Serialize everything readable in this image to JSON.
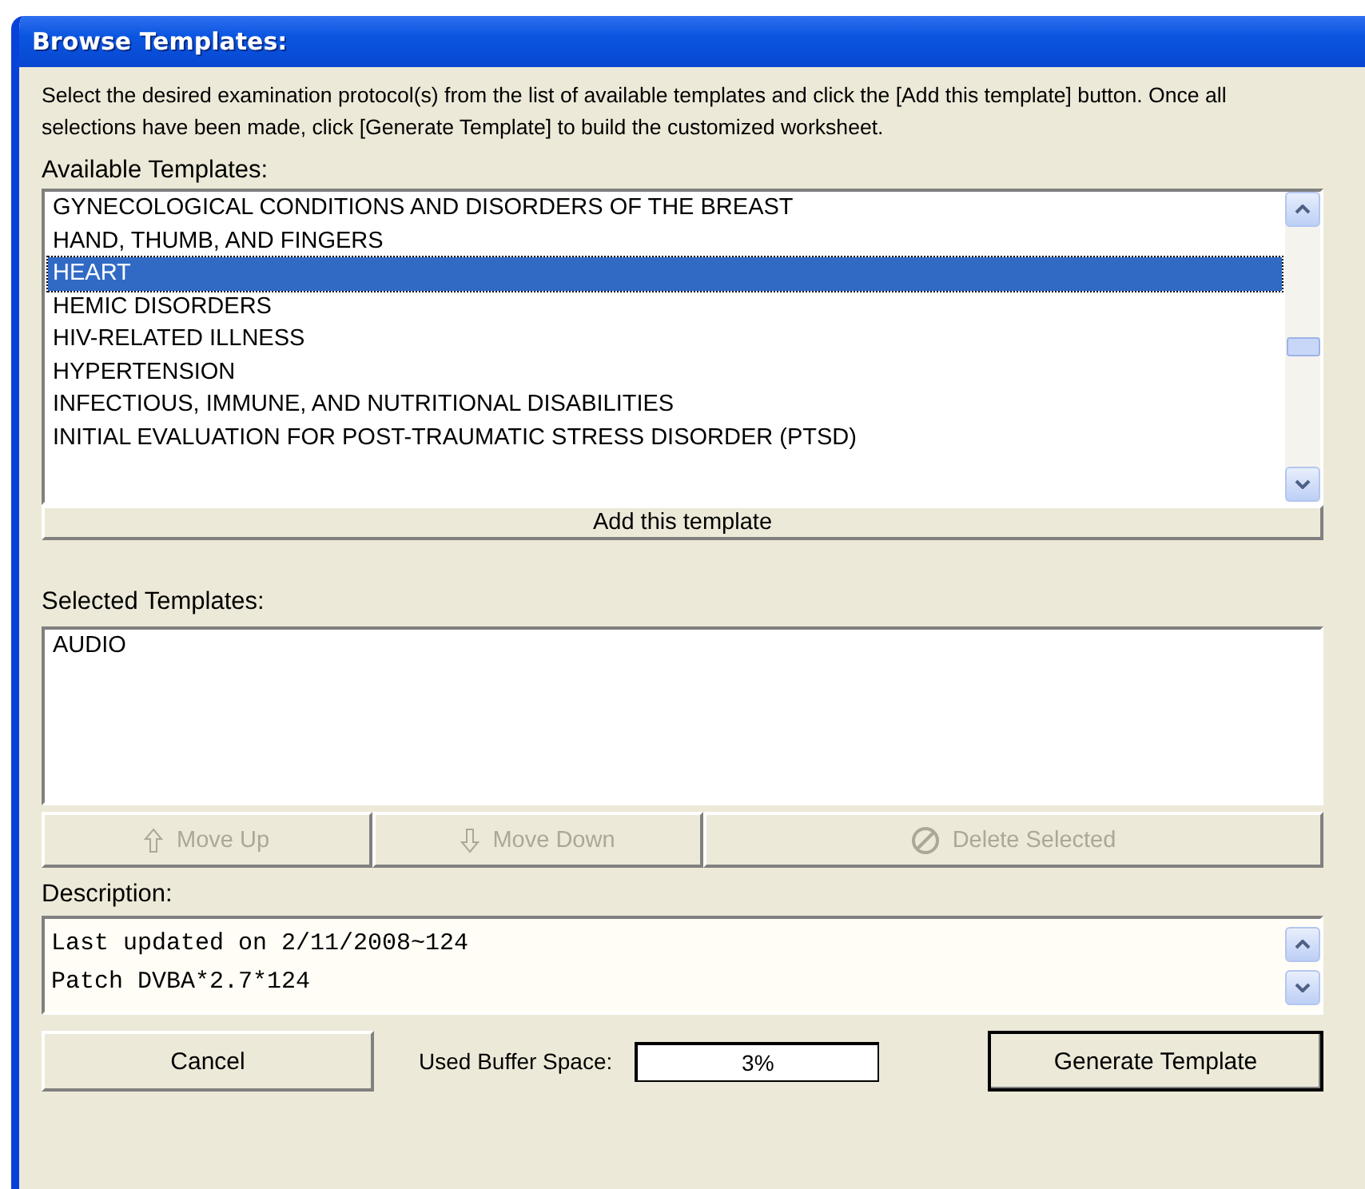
{
  "window": {
    "title": "Browse Templates:"
  },
  "instructions": "Select the desired examination protocol(s) from the list of available templates and click the [Add this template] button.  Once all selections have been made, click [Generate Template] to build the customized worksheet.",
  "available": {
    "label": "Available Templates:",
    "items": [
      {
        "text": "GYNECOLOGICAL CONDITIONS AND DISORDERS OF THE BREAST",
        "selected": false
      },
      {
        "text": "HAND, THUMB, AND FINGERS",
        "selected": false
      },
      {
        "text": "HEART",
        "selected": true
      },
      {
        "text": "HEMIC DISORDERS",
        "selected": false
      },
      {
        "text": "HIV-RELATED ILLNESS",
        "selected": false
      },
      {
        "text": "HYPERTENSION",
        "selected": false
      },
      {
        "text": "INFECTIOUS, IMMUNE, AND NUTRITIONAL DISABILITIES",
        "selected": false
      },
      {
        "text": "INITIAL EVALUATION FOR POST-TRAUMATIC STRESS DISORDER (PTSD)",
        "selected": false
      }
    ],
    "button": "Add this template"
  },
  "selected_templates": {
    "label": "Selected Templates:",
    "items": [
      {
        "text": "AUDIO"
      }
    ]
  },
  "actions": [
    {
      "kind": "up",
      "label": "Move Up",
      "disabled": true
    },
    {
      "kind": "down",
      "label": "Move Down",
      "disabled": true
    },
    {
      "kind": "delete",
      "label": "Delete Selected",
      "disabled": true
    }
  ],
  "description": {
    "label": "Description:",
    "lines": [
      "Last updated on 2/11/2008~124",
      "Patch DVBA*2.7*124"
    ]
  },
  "footer": {
    "cancel": "Cancel",
    "buffer_label": "Used Buffer Space:",
    "buffer_value": "3%",
    "generate": "Generate Template"
  }
}
